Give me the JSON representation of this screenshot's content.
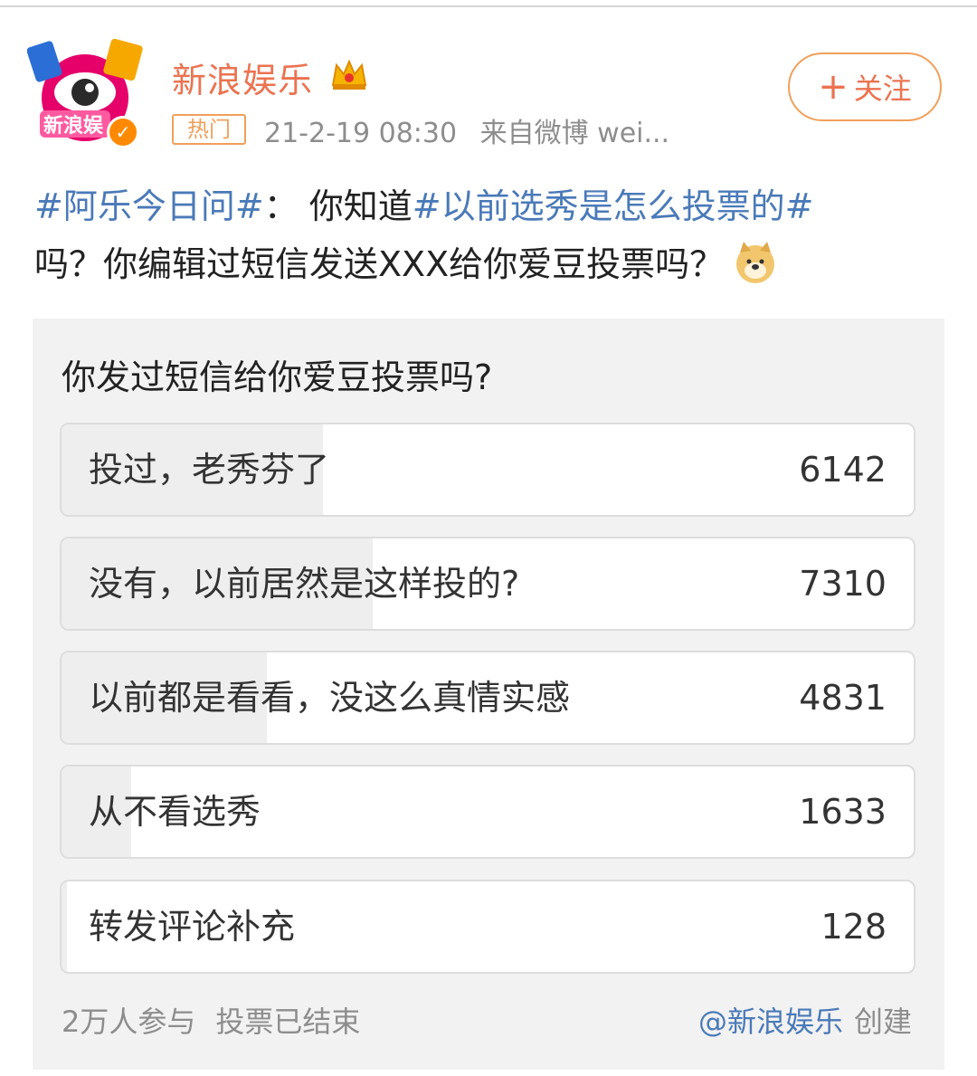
{
  "header": {
    "username": "新浪娱乐",
    "hot_badge": "热门",
    "timestamp": "21-2-19 08:30",
    "source": "来自微博 wei...",
    "follow_plus": "+",
    "follow_label": "关注",
    "avatar_text": "新浪娱"
  },
  "post": {
    "tag1": "#阿乐今日问#",
    "text1": "： 你知道",
    "tag2": "#以前选秀是怎么投票的#",
    "text2": "吗？你编辑过短信发送XXX给你爱豆投票吗？",
    "emoji": "doge-emoji"
  },
  "poll": {
    "title": "你发过短信给你爱豆投票吗?",
    "options": [
      {
        "label": "投过，老秀芬了",
        "count": "6142",
        "votes": 6142
      },
      {
        "label": "没有，以前居然是这样投的?",
        "count": "7310",
        "votes": 7310
      },
      {
        "label": "以前都是看看，没这么真情实感",
        "count": "4831",
        "votes": 4831
      },
      {
        "label": "从不看选秀",
        "count": "1633",
        "votes": 1633
      },
      {
        "label": "转发评论补充",
        "count": "128",
        "votes": 128
      }
    ],
    "participants": "2万人参与",
    "status": "投票已结束",
    "creator": "@新浪娱乐",
    "created_label": "创建"
  },
  "colors": {
    "accent": "#eb7350",
    "link": "#4a7ab8",
    "muted": "#8d8d8d",
    "poll_bg": "#f2f2f2"
  }
}
